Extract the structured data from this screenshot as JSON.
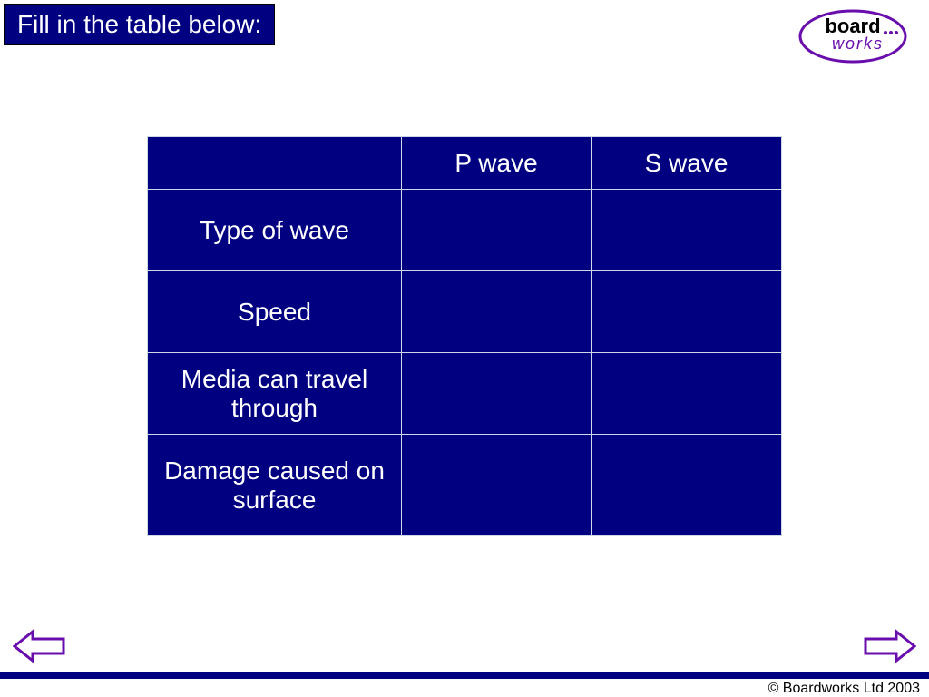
{
  "title": "Fill in the table below:",
  "logo": {
    "line1": "board",
    "line2": "works"
  },
  "table": {
    "columns": [
      "",
      "P wave",
      "S wave"
    ],
    "rows": [
      {
        "label": "Type of wave",
        "p": "",
        "s": ""
      },
      {
        "label": "Speed",
        "p": "",
        "s": ""
      },
      {
        "label": "Media can travel through",
        "p": "",
        "s": ""
      },
      {
        "label": "Damage caused on surface",
        "p": "",
        "s": ""
      }
    ]
  },
  "copyright": "© Boardworks Ltd 2003"
}
